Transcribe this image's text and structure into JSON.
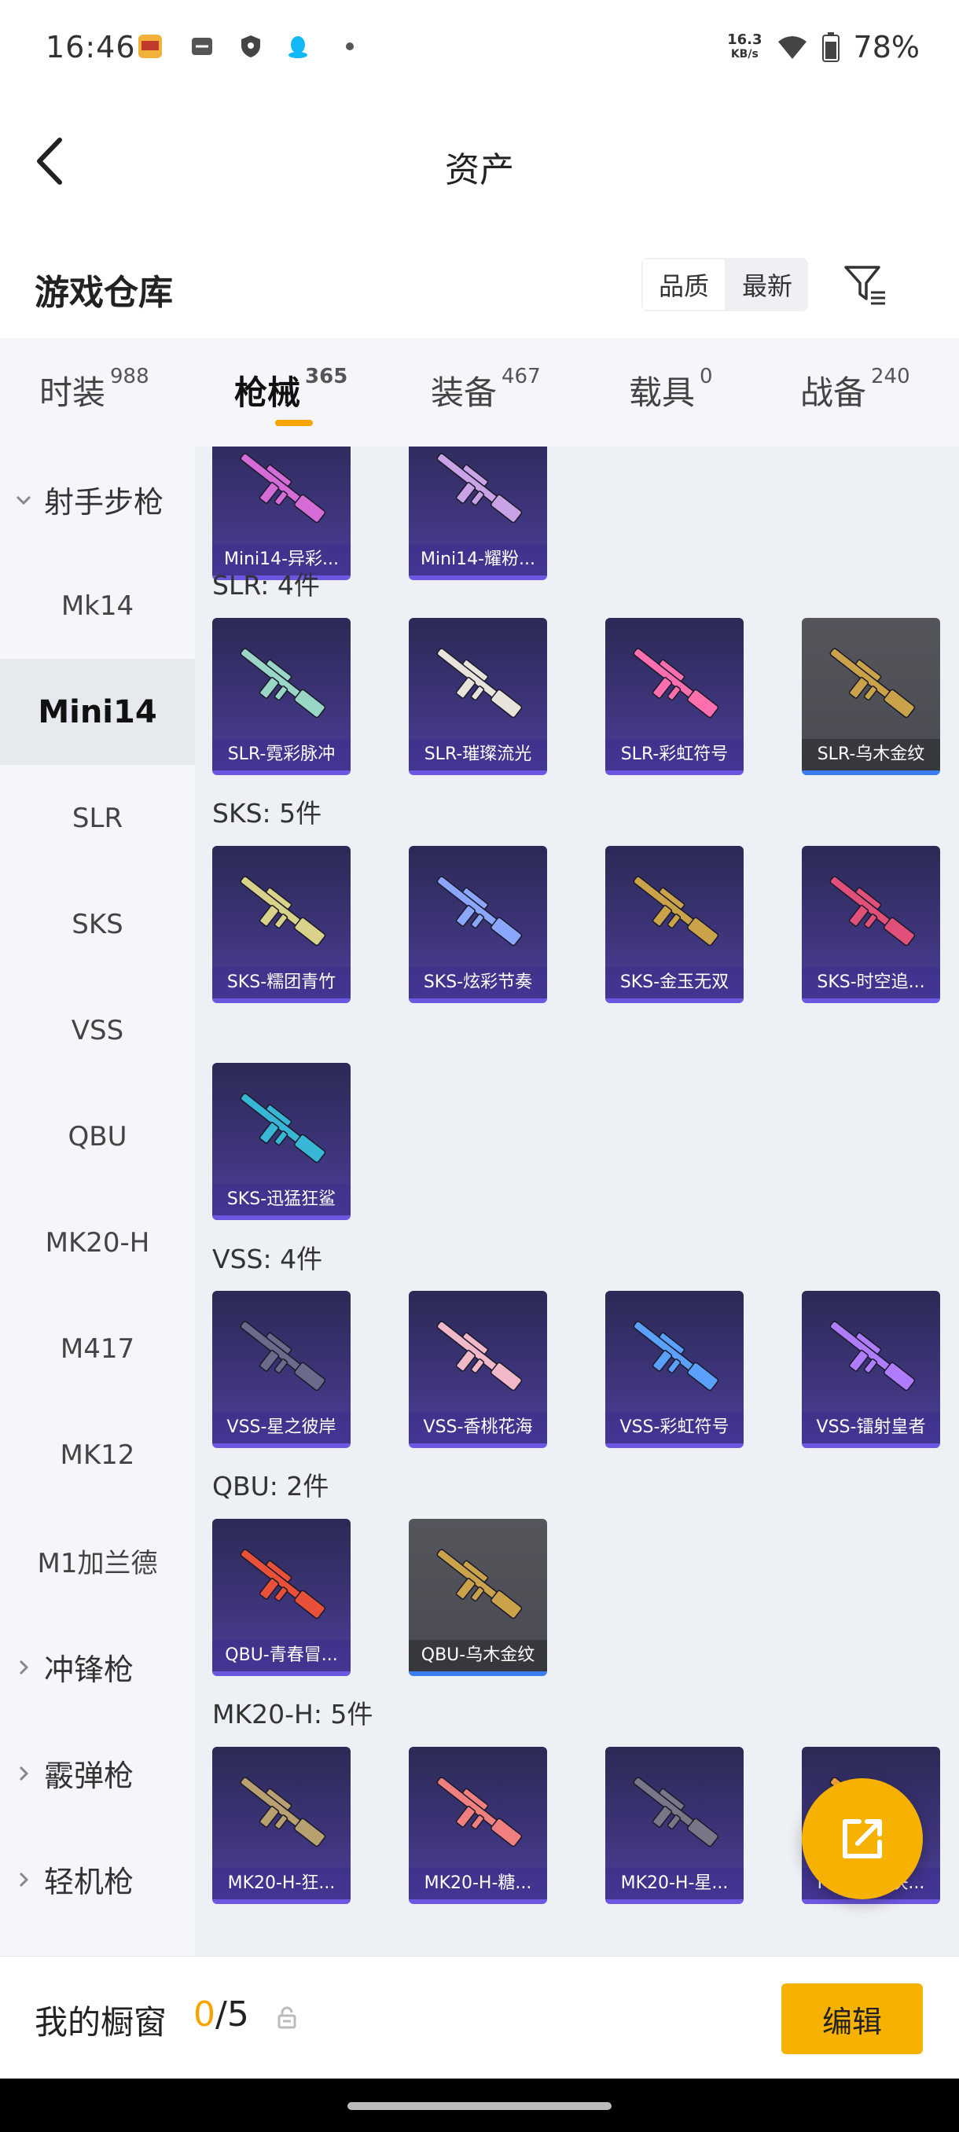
{
  "status_bar": {
    "time": "16:46",
    "speed_value": "16.3",
    "speed_unit": "KB/s",
    "battery": "78%"
  },
  "header": {
    "title": "资产"
  },
  "warehouse": {
    "title": "游戏仓库",
    "sort_options": [
      "品质",
      "最新"
    ],
    "active_sort": "品质"
  },
  "tabs": [
    {
      "label": "时装",
      "count": "988"
    },
    {
      "label": "枪械",
      "count": "365",
      "active": true
    },
    {
      "label": "装备",
      "count": "467"
    },
    {
      "label": "载具",
      "count": "0"
    },
    {
      "label": "战备",
      "count": "240"
    }
  ],
  "sidebar": {
    "group_expanded": "射手步枪",
    "items": [
      "Mk14",
      "Mini14",
      "SLR",
      "SKS",
      "VSS",
      "QBU",
      "MK20-H",
      "M417",
      "MK12",
      "M1加兰德"
    ],
    "active_item": "Mini14",
    "collapsed_groups": [
      "冲锋枪",
      "霰弹枪",
      "轻机枪"
    ]
  },
  "sections": [
    {
      "label": "",
      "items": [
        "Mini14-异彩...",
        "Mini14-耀粉..."
      ]
    },
    {
      "label": "SLR: 4件",
      "items": [
        "SLR-霓彩脉冲",
        "SLR-璀璨流光",
        "SLR-彩虹符号",
        "SLR-乌木金纹"
      ]
    },
    {
      "label": "SKS: 5件",
      "items": [
        "SKS-糯团青竹",
        "SKS-炫彩节奏",
        "SKS-金玉无双",
        "SKS-时空追...",
        "SKS-迅猛狂鲨"
      ]
    },
    {
      "label": "VSS: 4件",
      "items": [
        "VSS-星之彼岸",
        "VSS-香桃花海",
        "VSS-彩虹符号",
        "VSS-镭射皇者"
      ]
    },
    {
      "label": "QBU: 2件",
      "items": [
        "QBU-青春冒...",
        "QBU-乌木金纹"
      ]
    },
    {
      "label": "MK20-H: 5件",
      "items": [
        "MK20-H-狂...",
        "MK20-H-糖...",
        "MK20-H-星...",
        "MK20-H-决..."
      ]
    }
  ],
  "gun_colors": [
    "#d46bd6",
    "#c9a3e6",
    "#9ad6c8",
    "#e8e4dc",
    "#ff6fae",
    "#c9a24a",
    "#d9d28a",
    "#8aa6ff",
    "#c9a24a",
    "#e0507a",
    "#37b6d6",
    "#6a6a8a",
    "#f0b8c8",
    "#5aa0ff",
    "#b07cff",
    "#e8503a",
    "#c9a24a",
    "#b8a070",
    "#f08080",
    "#777788",
    "#f0a040"
  ],
  "bottom_bar": {
    "label": "我的橱窗",
    "current": "0",
    "total": "/5",
    "edit_label": "编辑"
  }
}
